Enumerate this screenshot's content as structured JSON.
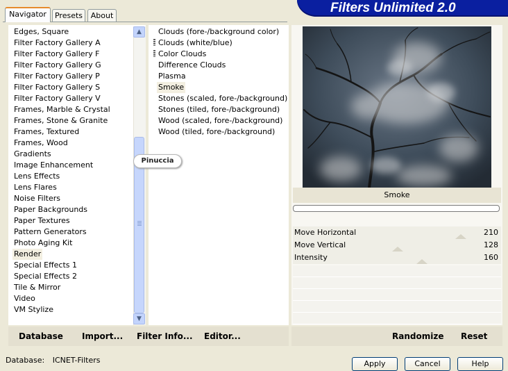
{
  "tabs": [
    {
      "label": "Navigator",
      "active": true
    },
    {
      "label": "Presets",
      "active": false
    },
    {
      "label": "About",
      "active": false
    }
  ],
  "banner": {
    "title": "Filters Unlimited 2.0"
  },
  "categories": [
    "Edges, Square",
    "Filter Factory Gallery A",
    "Filter Factory Gallery F",
    "Filter Factory Gallery G",
    "Filter Factory Gallery P",
    "Filter Factory Gallery S",
    "Filter Factory Gallery V",
    "Frames, Marble & Crystal",
    "Frames, Stone & Granite",
    "Frames, Textured",
    "Frames, Wood",
    "Gradients",
    "Image Enhancement",
    "Lens Effects",
    "Lens Flares",
    "Noise Filters",
    "Paper Backgrounds",
    "Paper Textures",
    "Pattern Generators",
    "Photo Aging Kit",
    "Render",
    "Special Effects 1",
    "Special Effects 2",
    "Tile & Mirror",
    "Video",
    "VM Stylize"
  ],
  "selected_category": "Render",
  "filters": [
    "Clouds (fore-/background color)",
    "Clouds (white/blue)",
    "Color Clouds",
    "Difference Clouds",
    "Plasma",
    "Smoke",
    "Stones (scaled, fore-/background)",
    "Stones (tiled, fore-/background)",
    "Wood (scaled, fore-/background)",
    "Wood (tiled, fore-/background)"
  ],
  "selected_filter": "Smoke",
  "watermark": "Pinuccia",
  "left_buttons": {
    "database": "Database",
    "import": "Import...",
    "filter_info": "Filter Info...",
    "editor": "Editor..."
  },
  "right_buttons": {
    "randomize": "Randomize",
    "reset": "Reset"
  },
  "preview_filter_name": "Smoke",
  "sliders": [
    {
      "label": "Move Horizontal",
      "value": "210",
      "fraction": 0.824
    },
    {
      "label": "Move Vertical",
      "value": "128",
      "fraction": 0.502
    },
    {
      "label": "Intensity",
      "value": "160",
      "fraction": 0.627
    }
  ],
  "status": {
    "label": "Database:",
    "value": "ICNET-Filters"
  },
  "dialog_buttons": {
    "apply": "Apply",
    "cancel": "Cancel",
    "help": "Help"
  },
  "icons": {
    "scroll_up": "chevron-up-icon",
    "scroll_down": "chevron-down-icon"
  },
  "colors": {
    "banner": "#0a1fa0",
    "window_bg": "#ece9d8",
    "active_tab_accent": "#e68b2c"
  }
}
